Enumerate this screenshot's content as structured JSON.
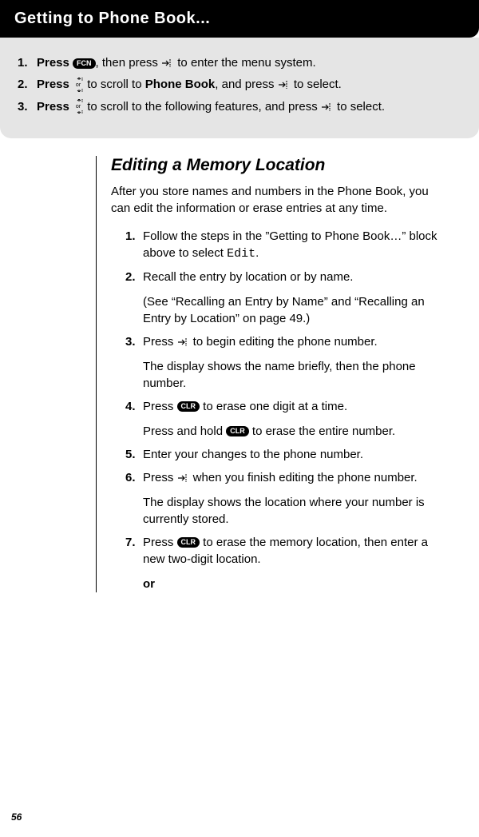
{
  "header": {
    "title": "Getting to Phone Book..."
  },
  "greybox": {
    "items": [
      {
        "num": "1.",
        "lead": "Press ",
        "pill": "FCN",
        "mid": ", then press ",
        "tail": " to enter the menu system."
      },
      {
        "num": "2.",
        "lead": "Press ",
        "mid1": " to scroll to ",
        "boldword": "Phone Book",
        "mid2": ", and press ",
        "tail": " to select."
      },
      {
        "num": "3.",
        "lead": "Press ",
        "mid": " to scroll to the following features, and press ",
        "tail": " to select."
      }
    ],
    "or_label": "or"
  },
  "section": {
    "title": "Editing a Memory Location",
    "intro": "After you store names and numbers in the Phone Book, you can edit the information or erase entries at any time.",
    "steps": [
      {
        "num": "1.",
        "text_a": "Follow the steps in the ”Getting to Phone Book…” block above to select ",
        "mono": "Edit",
        "text_b": "."
      },
      {
        "num": "2.",
        "text_a": "Recall the entry by location or by name.",
        "sub": "(See “Recalling an Entry by Name” and “Recalling an Entry by Location” on page 49.)"
      },
      {
        "num": "3.",
        "text_a": "Press ",
        "text_b": " to begin editing the phone number.",
        "sub": "The display shows the name briefly, then the phone number."
      },
      {
        "num": "4.",
        "text_a": "Press ",
        "pill": "CLR",
        "text_b": " to erase one digit at a time.",
        "sub_a": "Press and hold ",
        "sub_pill": "CLR",
        "sub_b": " to erase the entire number."
      },
      {
        "num": "5.",
        "text_a": "Enter your changes to the phone number."
      },
      {
        "num": "6.",
        "text_a": "Press ",
        "text_b": " when you finish editing the phone number.",
        "sub": "The display shows the location where your number is currently stored."
      },
      {
        "num": "7.",
        "text_a": "Press ",
        "pill": "CLR",
        "text_b": " to erase the memory location, then enter a new two-digit location.",
        "sub_bold": "or"
      }
    ]
  },
  "page_number": "56"
}
